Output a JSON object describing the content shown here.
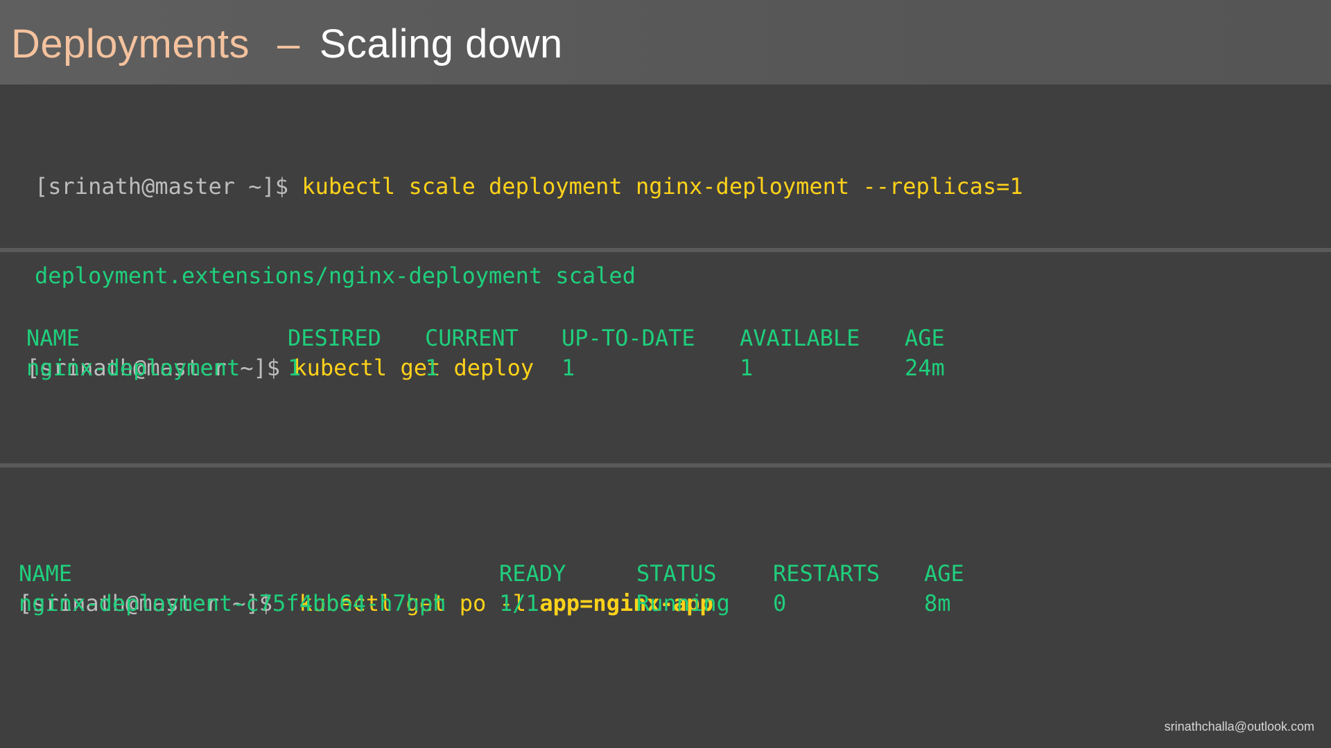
{
  "slide": {
    "title_main": "Deployments",
    "title_dash": "–",
    "title_sub": "Scaling down",
    "watermark": "srinathchalla@outlook.com"
  },
  "section1": {
    "prompt": "[srinath@master ~]$",
    "command": "kubectl scale deployment nginx-deployment --replicas=1",
    "output": "deployment.extensions/nginx-deployment scaled"
  },
  "section2": {
    "prompt": "[srinath@master ~]$",
    "command": "kubectl get deploy",
    "headers": [
      "NAME",
      "DESIRED",
      "CURRENT",
      "UP-TO-DATE",
      "AVAILABLE",
      "AGE"
    ],
    "rows": [
      [
        "nginx-deployment",
        "1",
        "1",
        "1",
        "1",
        "24m"
      ]
    ]
  },
  "section3": {
    "prompt": "[srinath@master ~]$",
    "command_plain": "kubectl get po -l ",
    "command_bold": "app=nginx-app",
    "headers": [
      "NAME",
      "READY",
      "STATUS",
      "RESTARTS",
      "AGE"
    ],
    "rows": [
      [
        "nginx-deployment-c75f4bb64-h7hph",
        "1/1",
        "Running",
        "0",
        "8m"
      ]
    ]
  },
  "colors": {
    "title_accent": "#f4c29e",
    "title_text": "#ffffff",
    "prompt": "#bdbdbd",
    "command": "#ffd21a",
    "output": "#1fcf7c",
    "background": "#3f3f3f"
  }
}
